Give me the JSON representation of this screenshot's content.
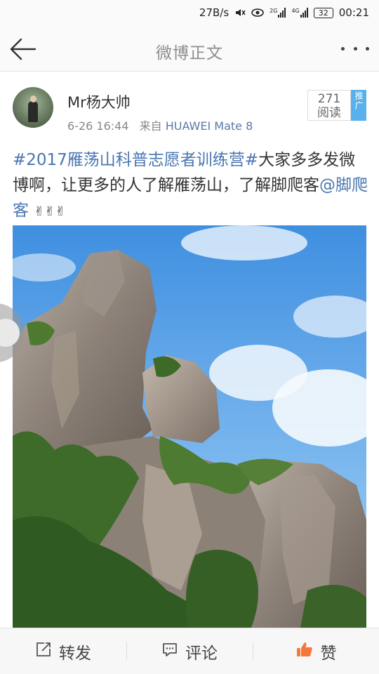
{
  "status_bar": {
    "net_speed": "27B/s",
    "network_2g": "2G",
    "network_4g": "4G",
    "battery": "32",
    "time": "00:21"
  },
  "nav": {
    "title": "微博正文"
  },
  "author": {
    "name": "Mr杨大帅",
    "date": "6-26 16:44",
    "source_prefix": "来自",
    "device": "HUAWEI Mate 8",
    "read_count": "271",
    "read_label": "阅读",
    "promo_tag": "推广"
  },
  "post": {
    "topic": "#2017雁荡山科普志愿者训练营#",
    "text": "大家多多发微博啊，让更多的人了解雁荡山，了解脚爬客",
    "mention": "@脚爬客",
    "emoji": "✌✌✌"
  },
  "actions": {
    "repost": "转发",
    "comment": "评论",
    "like": "赞"
  },
  "colors": {
    "link": "#4a76b0",
    "like_icon": "#f5783a",
    "promo": "#58b1ec"
  }
}
